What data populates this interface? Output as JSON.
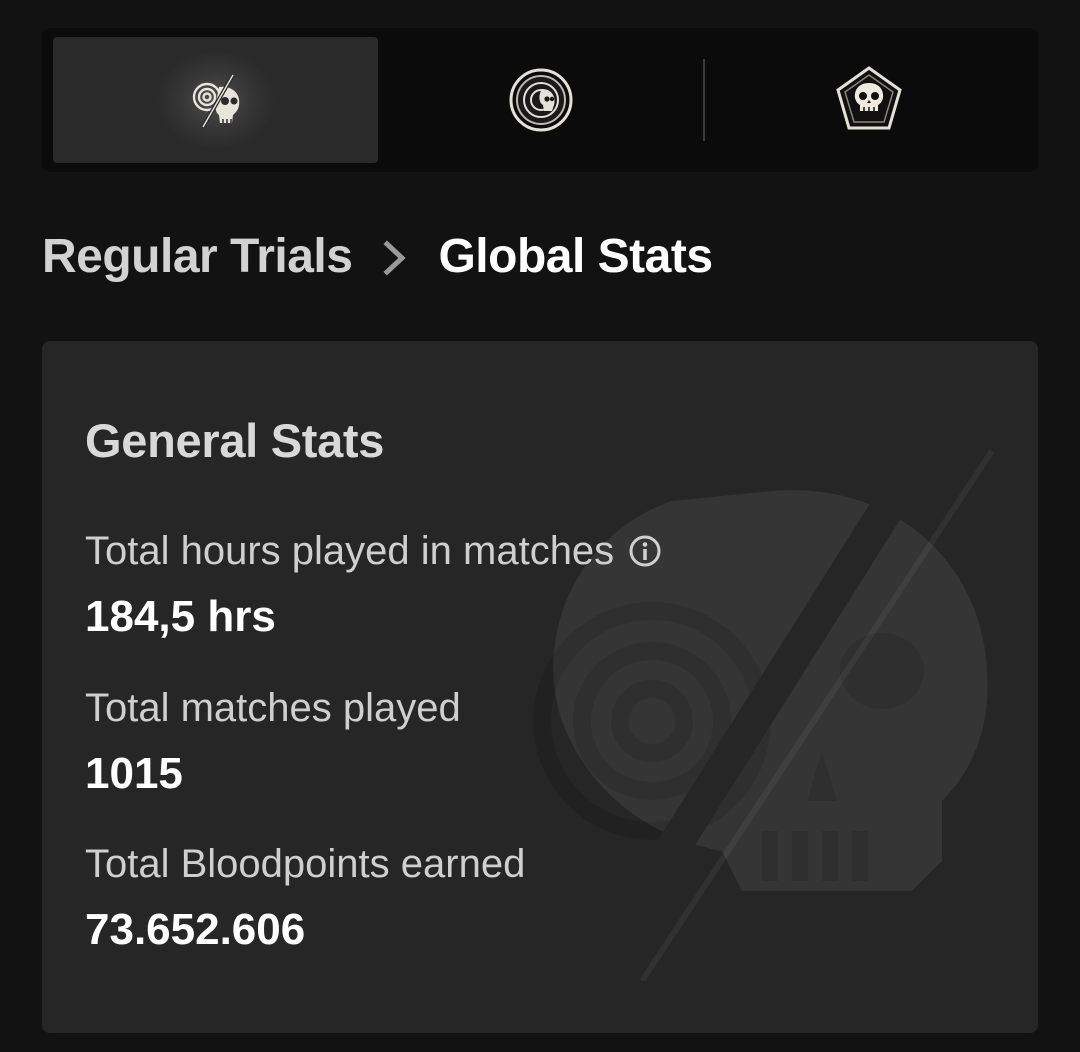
{
  "tabs": [
    {
      "icon": "broken-skull-emblem-icon",
      "selected": true
    },
    {
      "icon": "round-skull-medallion-icon",
      "selected": false
    },
    {
      "icon": "pentagon-skull-badge-icon",
      "selected": false
    }
  ],
  "breadcrumb": {
    "parent": "Regular Trials",
    "separator_icon": "chevron-right-icon",
    "current": "Global Stats"
  },
  "card": {
    "title": "General Stats",
    "stats": [
      {
        "label": "Total hours played in matches",
        "value": "184,5 hrs",
        "info_icon": "info-icon"
      },
      {
        "label": "Total matches played",
        "value": "1015"
      },
      {
        "label": "Total Bloodpoints earned",
        "value": "73.652.606"
      }
    ],
    "watermark_icon": "broken-skull-watermark-icon"
  },
  "colors": {
    "background": "#121212",
    "tabbar": "#0b0b0b",
    "tab_selected": "#2a2a2a",
    "card": "#262626",
    "text_primary": "#ffffff",
    "text_secondary": "#cfcfcf"
  }
}
